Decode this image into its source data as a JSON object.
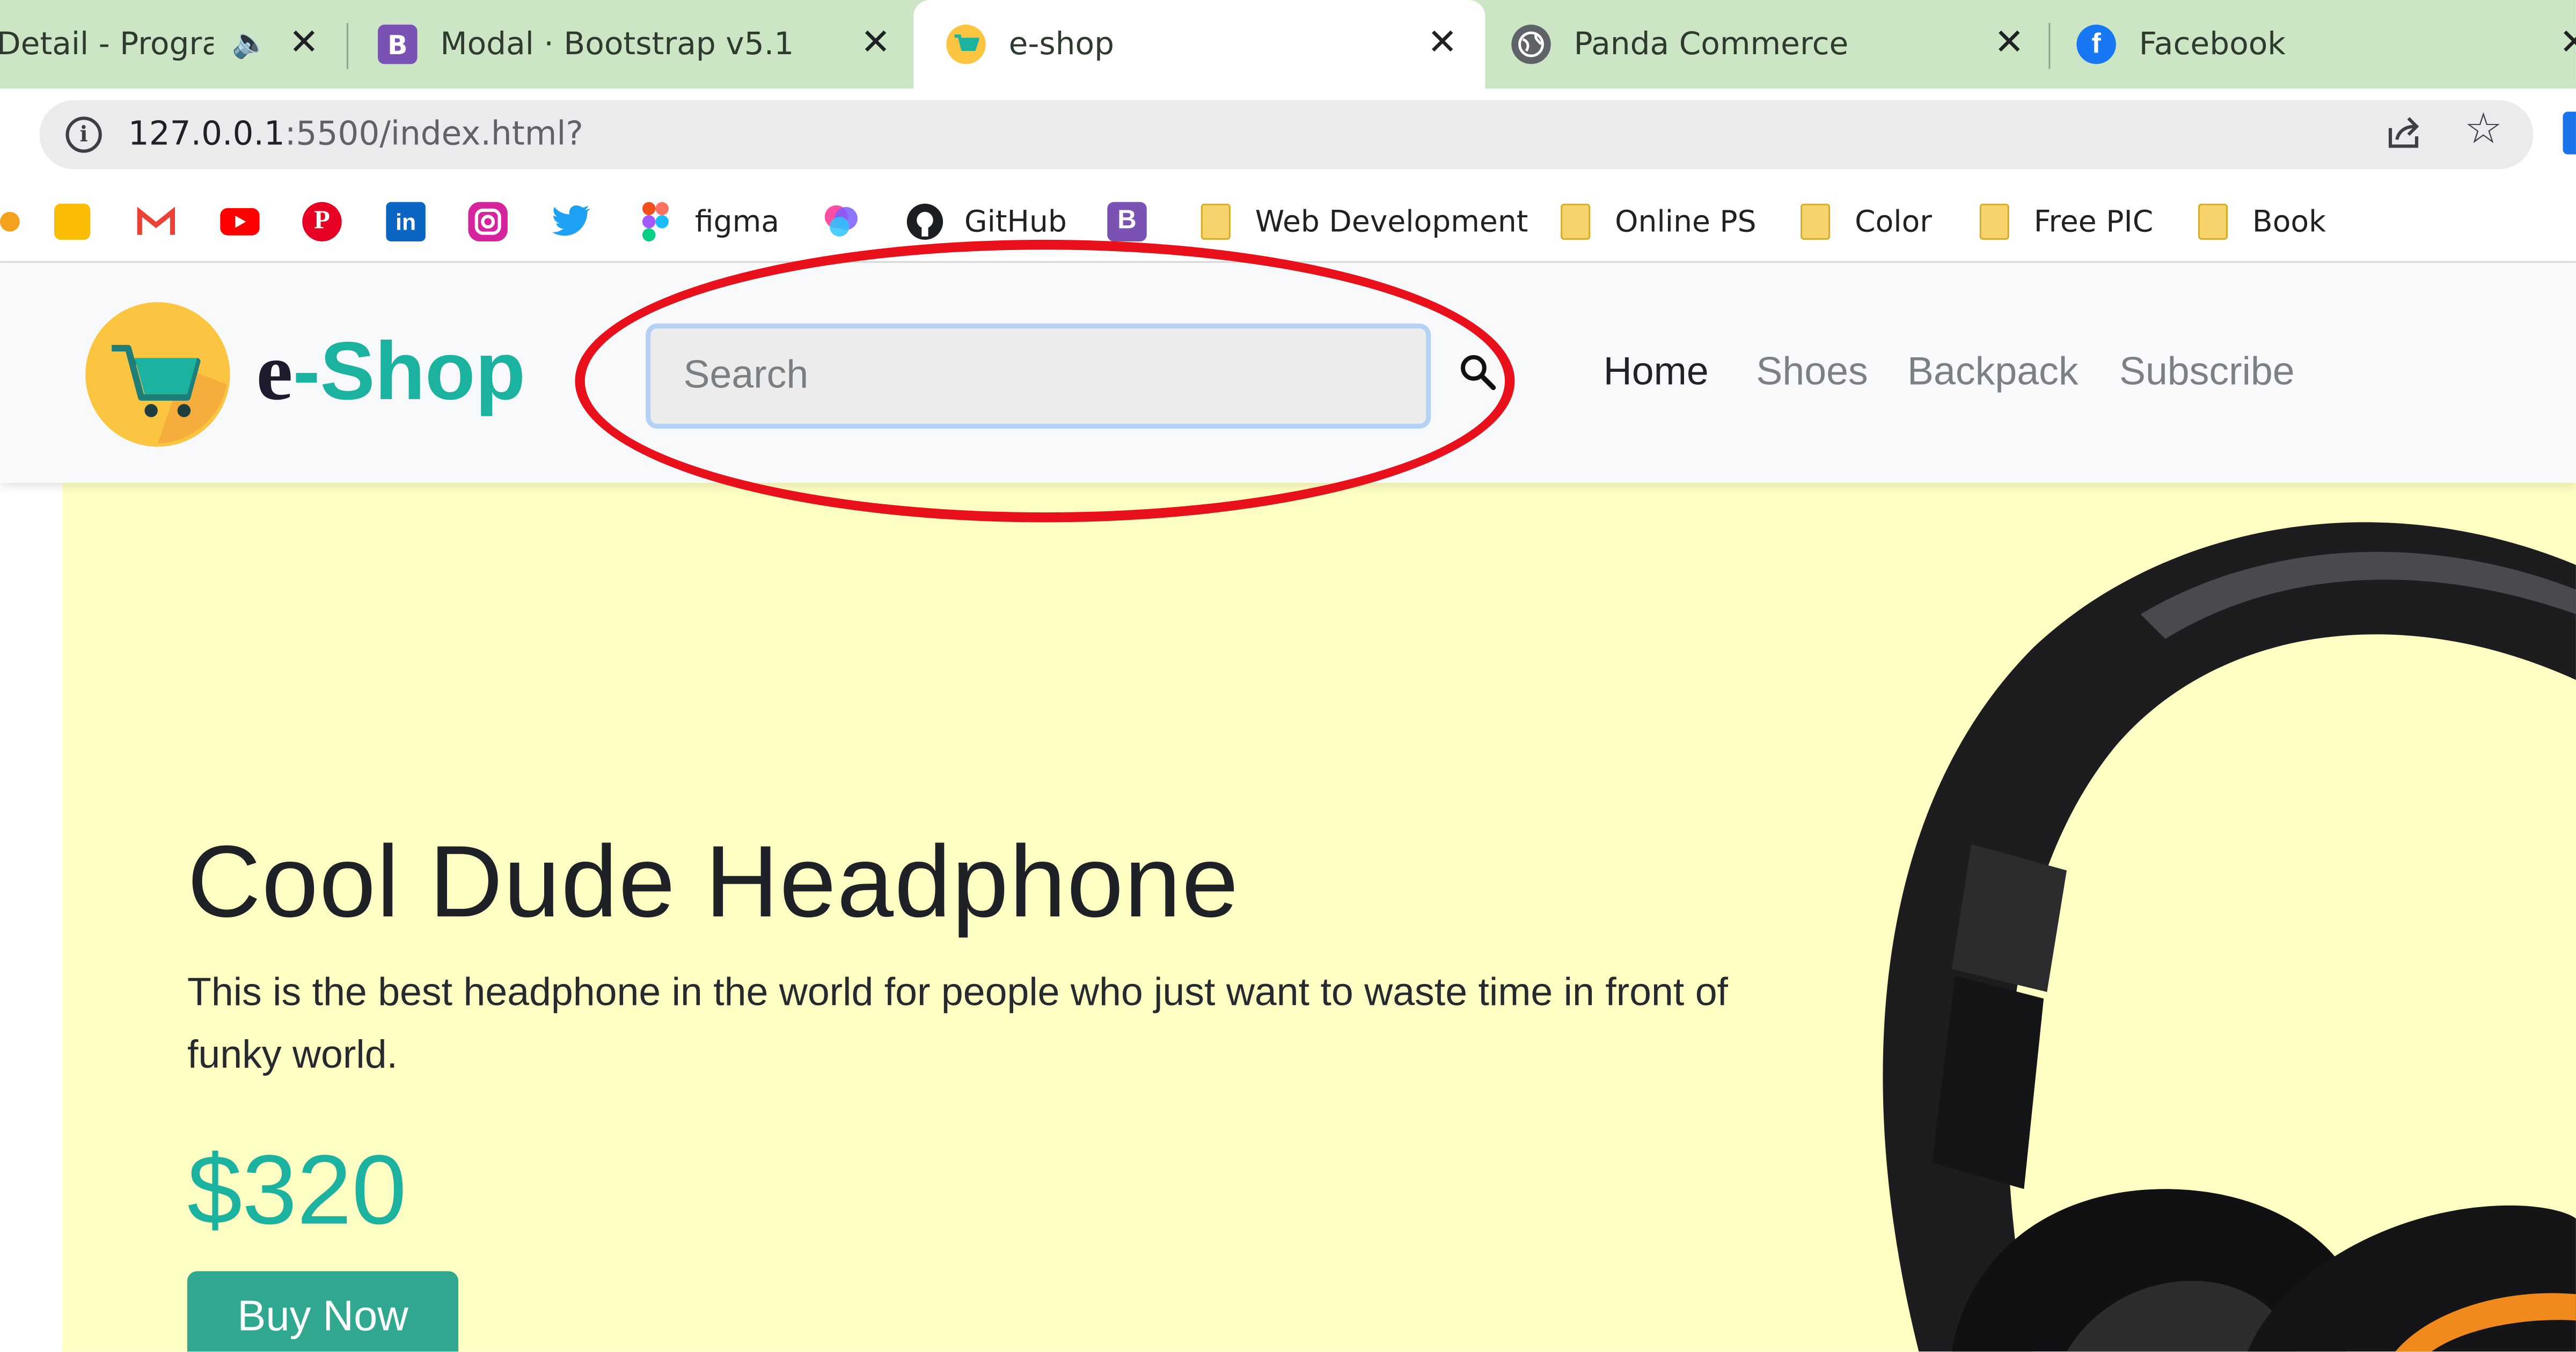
{
  "browser": {
    "tabs": [
      {
        "title": "Detail - Program",
        "active": false
      },
      {
        "title": "Modal · Bootstrap v5.1",
        "active": false,
        "favicon_letter": "B"
      },
      {
        "title": "e-shop",
        "active": true
      },
      {
        "title": "Panda Commerce",
        "active": false
      },
      {
        "title": "Facebook",
        "active": false
      }
    ],
    "address": {
      "host": "127.0.0.1",
      "rest": ":5500/index.html?"
    },
    "bookmarks": [
      {
        "label": "",
        "icon": "keep-icon"
      },
      {
        "label": "",
        "icon": "gmail-icon"
      },
      {
        "label": "",
        "icon": "youtube-icon"
      },
      {
        "label": "",
        "icon": "pinterest-icon"
      },
      {
        "label": "",
        "icon": "linkedin-icon"
      },
      {
        "label": "",
        "icon": "instagram-icon"
      },
      {
        "label": "",
        "icon": "twitter-icon"
      },
      {
        "label": "figma",
        "icon": "figma-icon"
      },
      {
        "label": "",
        "icon": "color-drop-icon"
      },
      {
        "label": "GitHub",
        "icon": "github-icon"
      },
      {
        "label": "",
        "icon": "bootstrap-icon",
        "letter": "B"
      },
      {
        "label": "Web Development",
        "icon": "folder-icon"
      },
      {
        "label": "Online PS",
        "icon": "folder-icon"
      },
      {
        "label": "Color",
        "icon": "folder-icon"
      },
      {
        "label": "Free PIC",
        "icon": "folder-icon"
      },
      {
        "label": "Book",
        "icon": "folder-icon"
      }
    ]
  },
  "navbar": {
    "brand_e": "e",
    "brand_rest": "-Shop",
    "search_placeholder": "Search",
    "links": [
      "Home",
      "Shoes",
      "Backpack",
      "Subscribe"
    ],
    "active_link": "Home"
  },
  "hero": {
    "title": "Cool Dude Headphone",
    "description": "This is the best headphone in the world for people who just want to waste time in front of funky world.",
    "price": "$320",
    "button": "Buy Now"
  },
  "colors": {
    "accent": "#1bb3a0",
    "hero_bg": "#ffffc4",
    "tab_strip": "#cbe5c5",
    "annotation": "#e8101a"
  }
}
